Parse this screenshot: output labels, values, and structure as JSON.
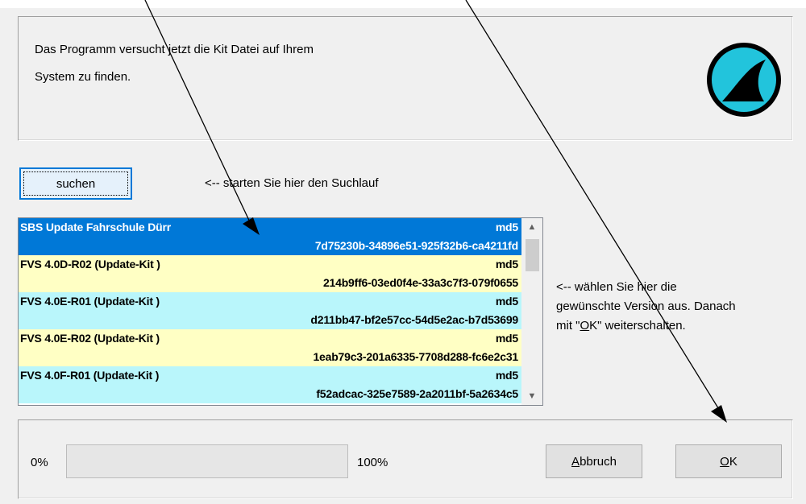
{
  "intro": {
    "line1": "Das Programm versucht jetzt die Kit Datei auf Ihrem",
    "line2": "System zu finden."
  },
  "logo": {
    "icon": "shark-fin-icon",
    "color": "#22c4dc"
  },
  "search": {
    "button_label": "suchen",
    "hint": "<-- starten Sie hier den Suchlauf"
  },
  "list": {
    "items": [
      {
        "name": "SBS Update Fahrschule Dürr",
        "hash_label": "md5",
        "hash": "7d75230b-34896e51-925f32b6-ca4211fd",
        "style": "selected"
      },
      {
        "name": "FVS 4.0D-R02 (Update-Kit )",
        "hash_label": "md5",
        "hash": "214b9ff6-03ed0f4e-33a3c7f3-079f0655",
        "style": "yellow"
      },
      {
        "name": "FVS 4.0E-R01 (Update-Kit )",
        "hash_label": "md5",
        "hash": "d211bb47-bf2e57cc-54d5e2ac-b7d53699",
        "style": "cyan"
      },
      {
        "name": "FVS 4.0E-R02 (Update-Kit )",
        "hash_label": "md5",
        "hash": "1eab79c3-201a6335-7708d288-fc6e2c31",
        "style": "yellow"
      },
      {
        "name": "FVS 4.0F-R01 (Update-Kit )",
        "hash_label": "md5",
        "hash": "f52adcac-325e7589-2a2011bf-5a2634c5",
        "style": "cyan"
      }
    ],
    "scroll_up_icon": "scroll-up-arrow",
    "scroll_down_icon": "scroll-down-arrow"
  },
  "select_hint": {
    "line1": "<-- wählen Sie hier die",
    "line2": "gewünschte Version aus. Danach",
    "line3_pre": "mit \"",
    "line3_underlined": "O",
    "line3_post": "K\" weiterschalten."
  },
  "progress": {
    "start_label": "0%",
    "end_label": "100%",
    "value_percent": 0
  },
  "buttons": {
    "cancel_underlined": "A",
    "cancel_rest": "bbruch",
    "ok_underlined": "O",
    "ok_rest": "K"
  },
  "colors": {
    "selected": "#0078d7",
    "row_yellow": "#ffffc4",
    "row_cyan": "#b9f6fb"
  }
}
